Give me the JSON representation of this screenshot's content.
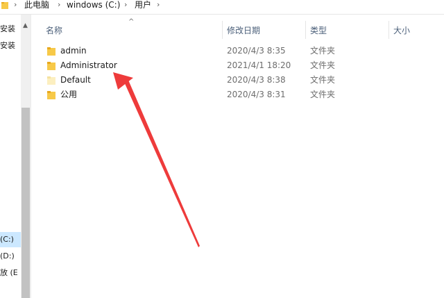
{
  "breadcrumb": {
    "items": [
      "此电脑",
      "windows (C:)",
      "用户"
    ],
    "separator": "›"
  },
  "nav": {
    "items": [
      {
        "label": "安装",
        "selected": false
      },
      {
        "label": "安装",
        "selected": false
      },
      {
        "label": "(C:)",
        "selected": true
      },
      {
        "label": "(D:)",
        "selected": false
      },
      {
        "label": "放 (E",
        "selected": false
      }
    ]
  },
  "columns": {
    "name": "名称",
    "date": "修改日期",
    "type": "类型",
    "size": "大小"
  },
  "files": [
    {
      "name": "admin",
      "date": "2020/4/3 8:35",
      "type": "文件夹",
      "icon": "folder-icon"
    },
    {
      "name": "Administrator",
      "date": "2021/4/1 18:20",
      "type": "文件夹",
      "icon": "folder-icon"
    },
    {
      "name": "Default",
      "date": "2020/4/3 8:38",
      "type": "文件夹",
      "icon": "folder-hidden-icon"
    },
    {
      "name": "公用",
      "date": "2020/4/3 8:31",
      "type": "文件夹",
      "icon": "folder-icon"
    }
  ],
  "colors": {
    "folder": "#f7c948",
    "folder_dark": "#e8a91f",
    "folder_hidden": "#fcefc0",
    "header_text": "#4c607a",
    "selected": "#cce8ff",
    "annotation_red": "#ee3b3b"
  }
}
